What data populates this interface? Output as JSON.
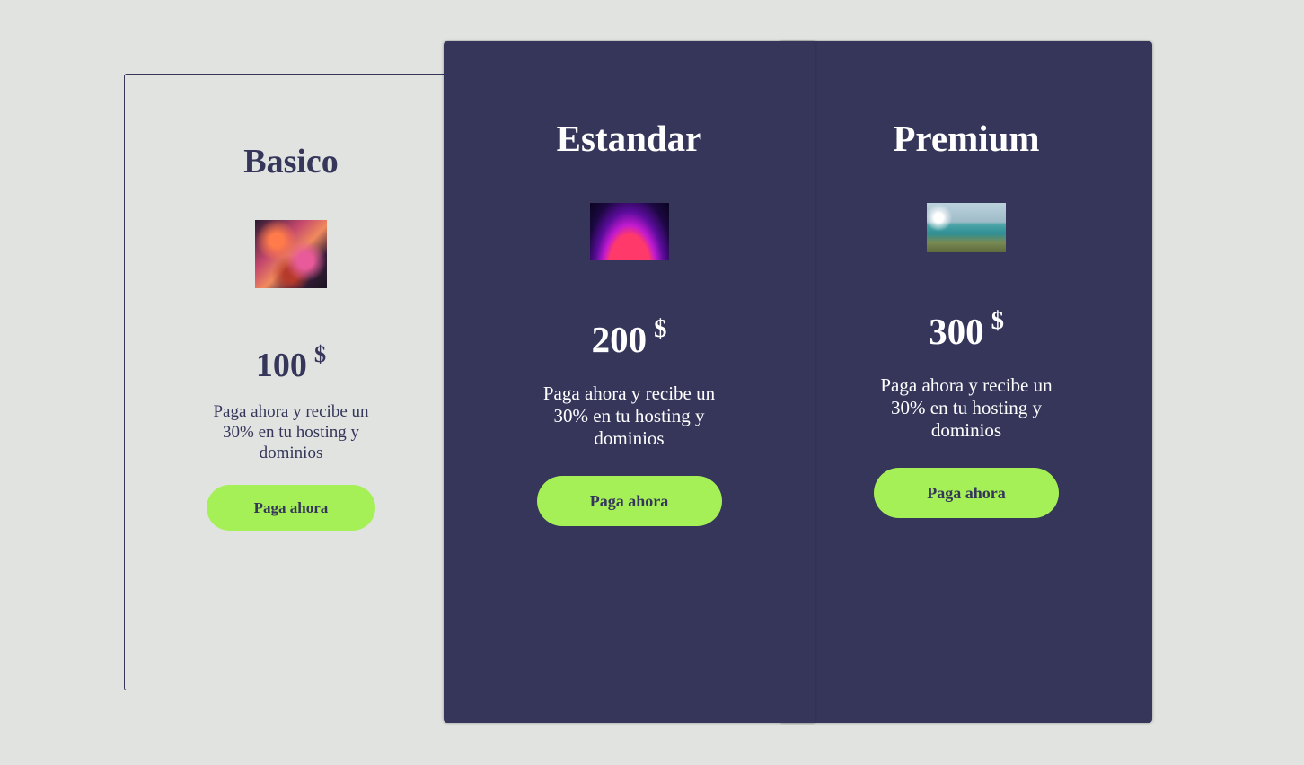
{
  "theme": {
    "background": "#e1e3e1",
    "card_dark": "#35365a",
    "accent_button": "#a6f057",
    "text_dark": "#35365a",
    "text_light": "#ffffff"
  },
  "plans": [
    {
      "name": "Basico",
      "image": "abstract-ribbons-image",
      "price": "100",
      "currency": "$",
      "description": "Paga ahora y recibe un 30% en tu hosting y dominios",
      "button_label": "Paga ahora"
    },
    {
      "name": "Estandar",
      "image": "purple-glow-image",
      "price": "200",
      "currency": "$",
      "description": "Paga ahora y recibe un 30% en tu hosting y dominios",
      "button_label": "Paga ahora"
    },
    {
      "name": "Premium",
      "image": "lake-landscape-image",
      "price": "300",
      "currency": "$",
      "description": "Paga ahora y recibe un 30% en tu hosting y dominios",
      "button_label": "Paga ahora"
    }
  ]
}
